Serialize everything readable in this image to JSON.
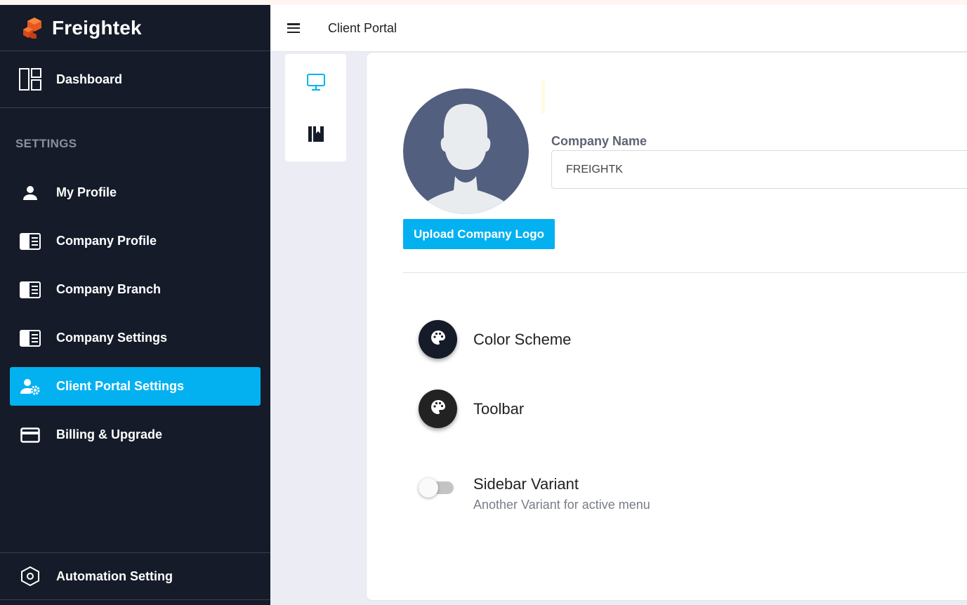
{
  "brand": {
    "name": "Freightek",
    "logo_icon": "freightek-cubes-logo"
  },
  "header": {
    "title": "Client Portal",
    "menu_icon": "hamburger-icon"
  },
  "sidebar": {
    "dashboard": {
      "label": "Dashboard",
      "icon": "dashboard-icon"
    },
    "section_title": "SETTINGS",
    "items": [
      {
        "label": "My Profile",
        "icon": "person-icon"
      },
      {
        "label": "Company Profile",
        "icon": "card-list-icon"
      },
      {
        "label": "Company Branch",
        "icon": "card-list-icon"
      },
      {
        "label": "Company Settings",
        "icon": "card-list-icon"
      },
      {
        "label": "Client Portal Settings",
        "icon": "user-gear-icon",
        "active": true
      },
      {
        "label": "Billing & Upgrade",
        "icon": "credit-card-icon"
      }
    ],
    "bottom": {
      "label": "Automation Setting",
      "icon": "hexagon-settings-icon"
    },
    "active_color": "#03b1f1",
    "background": "#151b29"
  },
  "tabs": [
    {
      "icon": "monitor-icon",
      "active": true
    },
    {
      "icon": "book-icon",
      "active": false
    }
  ],
  "profile": {
    "avatar_icon": "default-avatar-icon",
    "company_name_label": "Company Name",
    "company_name_value": "FREIGHTK",
    "upload_button": "Upload Company Logo"
  },
  "settings": {
    "color_scheme": {
      "label": "Color Scheme",
      "icon": "palette-icon",
      "button_color": "#151b29"
    },
    "toolbar": {
      "label": "Toolbar",
      "icon": "palette-icon",
      "button_color": "#222222"
    },
    "sidebar_variant": {
      "label": "Sidebar Variant",
      "description": "Another Variant for active menu",
      "enabled": false
    }
  }
}
